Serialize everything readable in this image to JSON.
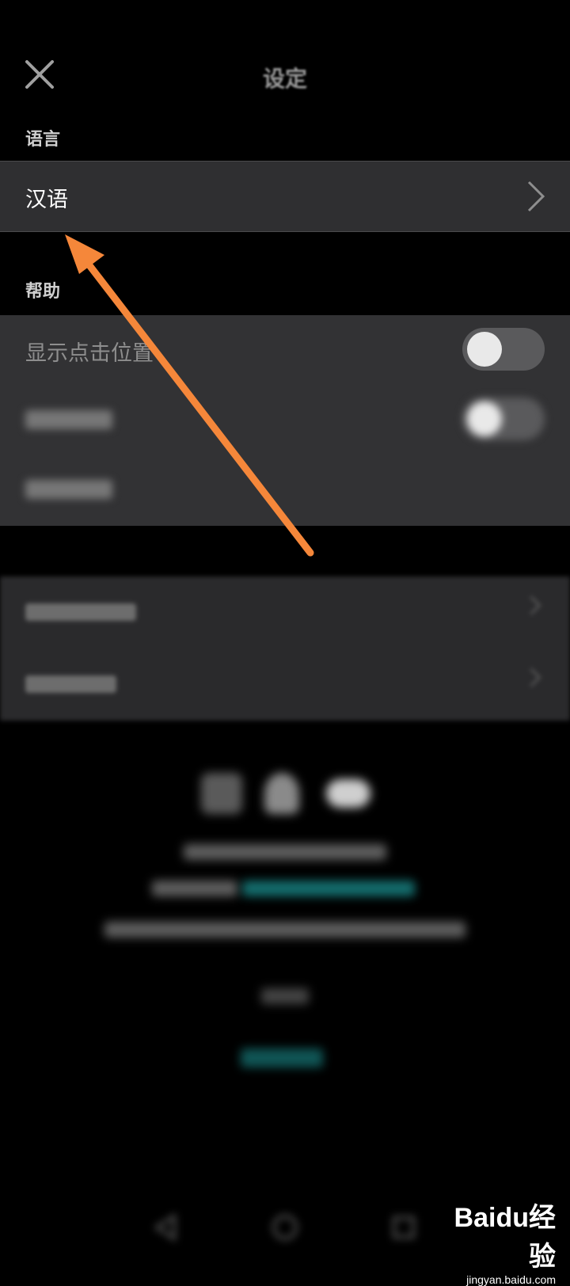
{
  "header": {
    "title": "设定"
  },
  "language_section": {
    "label": "语言",
    "value": "汉语"
  },
  "help_section": {
    "label": "帮助",
    "items": [
      {
        "label": "显示点击位置",
        "toggle_on": false
      }
    ]
  },
  "watermark": {
    "brand": "Baidu经验",
    "url": "jingyan.baidu.com"
  },
  "colors": {
    "arrow": "#F5873A",
    "accent_link": "#1E9C9C",
    "row_bg": "#2F2F31"
  }
}
